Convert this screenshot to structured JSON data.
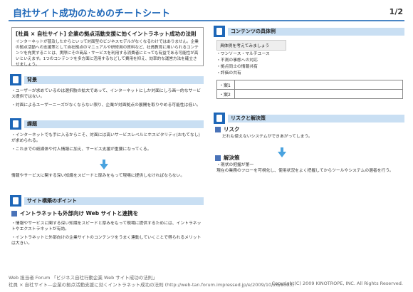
{
  "header": {
    "title": "自社サイト成功のためのチートシート",
    "page_no": "1/2"
  },
  "intro": {
    "title": "[社員 × 自社サイト] 企業の拠点活動支援に効くイントラネット成功の法則",
    "body": "インターネットが普及したからといって対面型のビジネスモデルがなくなるわけではありません。企業の拠点活動への支援策として自社拠点のマニュアルや研修用の資料など、社員教育に用いられるコンテンツを充実することは、実際にその商品・サービスを利用する消費者にとっても有益である可能性が高いといえます。1つのコンテンツを多方面に活用するなどして費用を抑え、効率的な運営方法を確立させましょう。"
  },
  "sections": {
    "background": {
      "heading": "背景",
      "items": [
        "・ユーザーが求めているのは選択肢の拡大であって、インターネットにしか対面にしろ画一的なサービス提供ではない。",
        "・対面によるユーザーニーズがなくならない限り、企業が対面拠点の展開を取りやめる可能性は低い。"
      ]
    },
    "issues": {
      "heading": "課題",
      "items": [
        "・インターネットでも手に入るからこそ、対面には高いサービスレベルとホスピタリティ(おもてなし)が求められる。",
        "・これまでの紙媒体や付人情報に加え、サービス支援が重要になってくる。"
      ],
      "conclusion": "情報やサービスに関する深い知識をスピードと厚みをもって現場に提供しなければならない。"
    },
    "points": {
      "heading": "サイト構築のポイント",
      "subheading": "イントラネットも外部向け Web サイトと連携を",
      "items": [
        "・情報やサービスに関する深い知識をスピードと厚みをもって現場に提供するためには、イントラネットやエクストラネットが有効。",
        "・イントラネットと外部向けの企業サイトのコンテンツをうまく連動していくことで得られるメリットは大きい。"
      ]
    },
    "contents": {
      "heading": "コンテンツの具体例",
      "example_label": "具体例を考えてみましょう",
      "items": [
        "・ワンソース・マルチユース",
        "・不測の事態への対応",
        "・拠点同士の情報共有",
        "・評価の共有"
      ],
      "cases": [
        "・案1",
        "・案2"
      ]
    },
    "risks": {
      "heading": "リスクと解決策",
      "risk_label": "リスク",
      "risk_text": "だれも使えないシステムができあがってしまう。",
      "solution_label": "解決策",
      "solution_text": "・現状の把握が第一\n現在の業務のフローを可視化し、使用状況をよく把握してからツールやシステムの選者を行う。"
    }
  },
  "footer": {
    "source": "Web 担当者 Forum 「ビジネス自社行動企業 Web サイト成功の法則」",
    "url": "社員 × 自社サイト―企業の拠点活動支援に効くイントラネット成功の法則 (http://web-tan.forum.impressed.jp/e/2009/10/26/6603)",
    "copyright": "Copyright(C) 2009 KINOTROPE, INC. All Rights Reserved."
  },
  "colors": {
    "accent": "#1e67b8",
    "band": "#c9dff3",
    "arrow": "#4aa3df"
  }
}
